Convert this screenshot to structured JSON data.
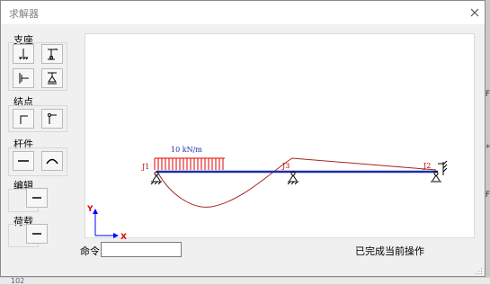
{
  "window": {
    "title": "求解器"
  },
  "toolbox": {
    "support_label": "支座",
    "node_label": "结点",
    "member_label": "杆件",
    "edit_label": "编辑",
    "load_label": "荷载"
  },
  "diagram": {
    "load_text": "10 kN/m",
    "node_j1": "J1",
    "node_j3": "J3",
    "node_j2": "J2",
    "axis_x": "X",
    "axis_y": "Y"
  },
  "command": {
    "label": "命令",
    "value": ""
  },
  "status": {
    "text": "已完成当前操作"
  },
  "colors": {
    "beam": "#1c2fa8",
    "load": "#e00000",
    "moment_curve": "#a32424",
    "node_text": "#c00000",
    "axis": "#0000ff"
  },
  "background_text": {
    "bottom_left": "102"
  }
}
